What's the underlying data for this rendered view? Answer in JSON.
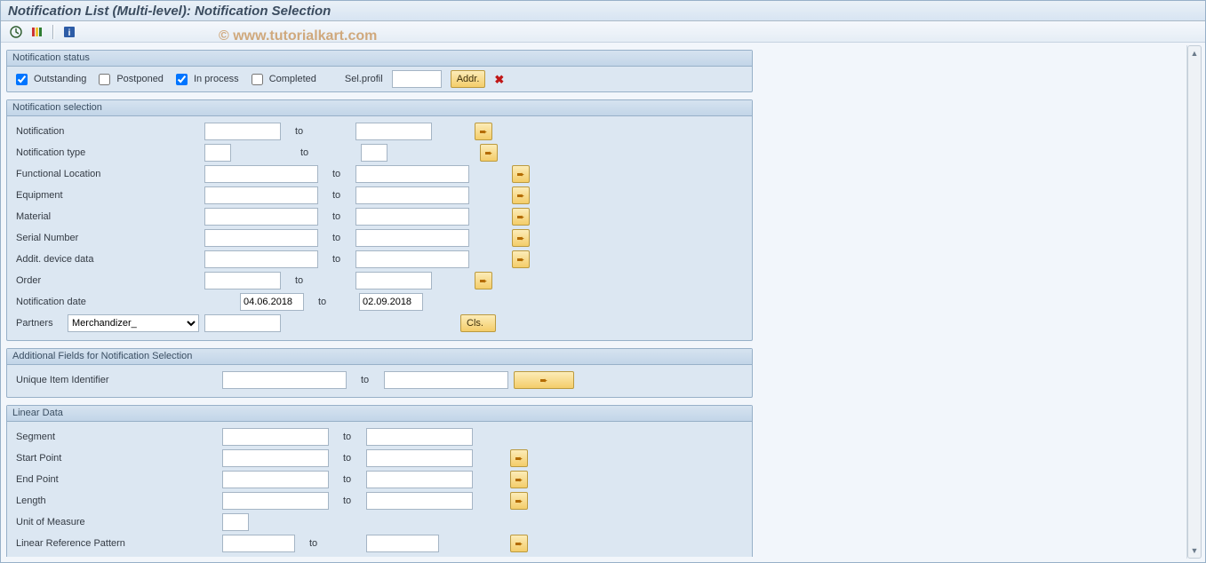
{
  "title": "Notification List (Multi-level): Notification Selection",
  "watermark": "© www.tutorialkart.com",
  "toolbar": {
    "execute_tip": "Execute",
    "variants_tip": "Variants",
    "info_tip": "Information"
  },
  "status": {
    "legend": "Notification status",
    "outstanding": {
      "label": "Outstanding",
      "checked": true
    },
    "postponed": {
      "label": "Postponed",
      "checked": false
    },
    "inprocess": {
      "label": "In process",
      "checked": true
    },
    "completed": {
      "label": "Completed",
      "checked": false
    },
    "selprofil_label": "Sel.profil",
    "selprofil_value": "",
    "addr_label": "Addr.",
    "delete_tip": "Delete"
  },
  "selection": {
    "legend": "Notification selection",
    "to": "to",
    "rows": {
      "notification": {
        "label": "Notification",
        "from": "",
        "to": ""
      },
      "type": {
        "label": "Notification type",
        "from": "",
        "to": ""
      },
      "funcloc": {
        "label": "Functional Location",
        "from": "",
        "to": ""
      },
      "equipment": {
        "label": "Equipment",
        "from": "",
        "to": ""
      },
      "material": {
        "label": "Material",
        "from": "",
        "to": ""
      },
      "serial": {
        "label": "Serial Number",
        "from": "",
        "to": ""
      },
      "addit": {
        "label": "Addit. device data",
        "from": "",
        "to": ""
      },
      "order": {
        "label": "Order",
        "from": "",
        "to": ""
      },
      "date": {
        "label": "Notification date",
        "from": "04.06.2018",
        "to": "02.09.2018"
      }
    },
    "partners_label": "Partners",
    "partners_value": "Merchandizer_",
    "partner_val": "",
    "cls_label": "Cls."
  },
  "additional": {
    "legend": "Additional Fields for Notification Selection",
    "to": "to",
    "uii": {
      "label": "Unique Item Identifier",
      "from": "",
      "to": ""
    }
  },
  "linear": {
    "legend": "Linear Data",
    "to": "to",
    "segment": {
      "label": "Segment",
      "from": "",
      "to": ""
    },
    "start": {
      "label": "Start Point",
      "from": "",
      "to": ""
    },
    "end": {
      "label": "End Point",
      "from": "",
      "to": ""
    },
    "length": {
      "label": "Length",
      "from": "",
      "to": ""
    },
    "uom": {
      "label": "Unit of Measure",
      "value": ""
    },
    "lrp": {
      "label": "Linear Reference Pattern",
      "from": "",
      "to": ""
    }
  }
}
